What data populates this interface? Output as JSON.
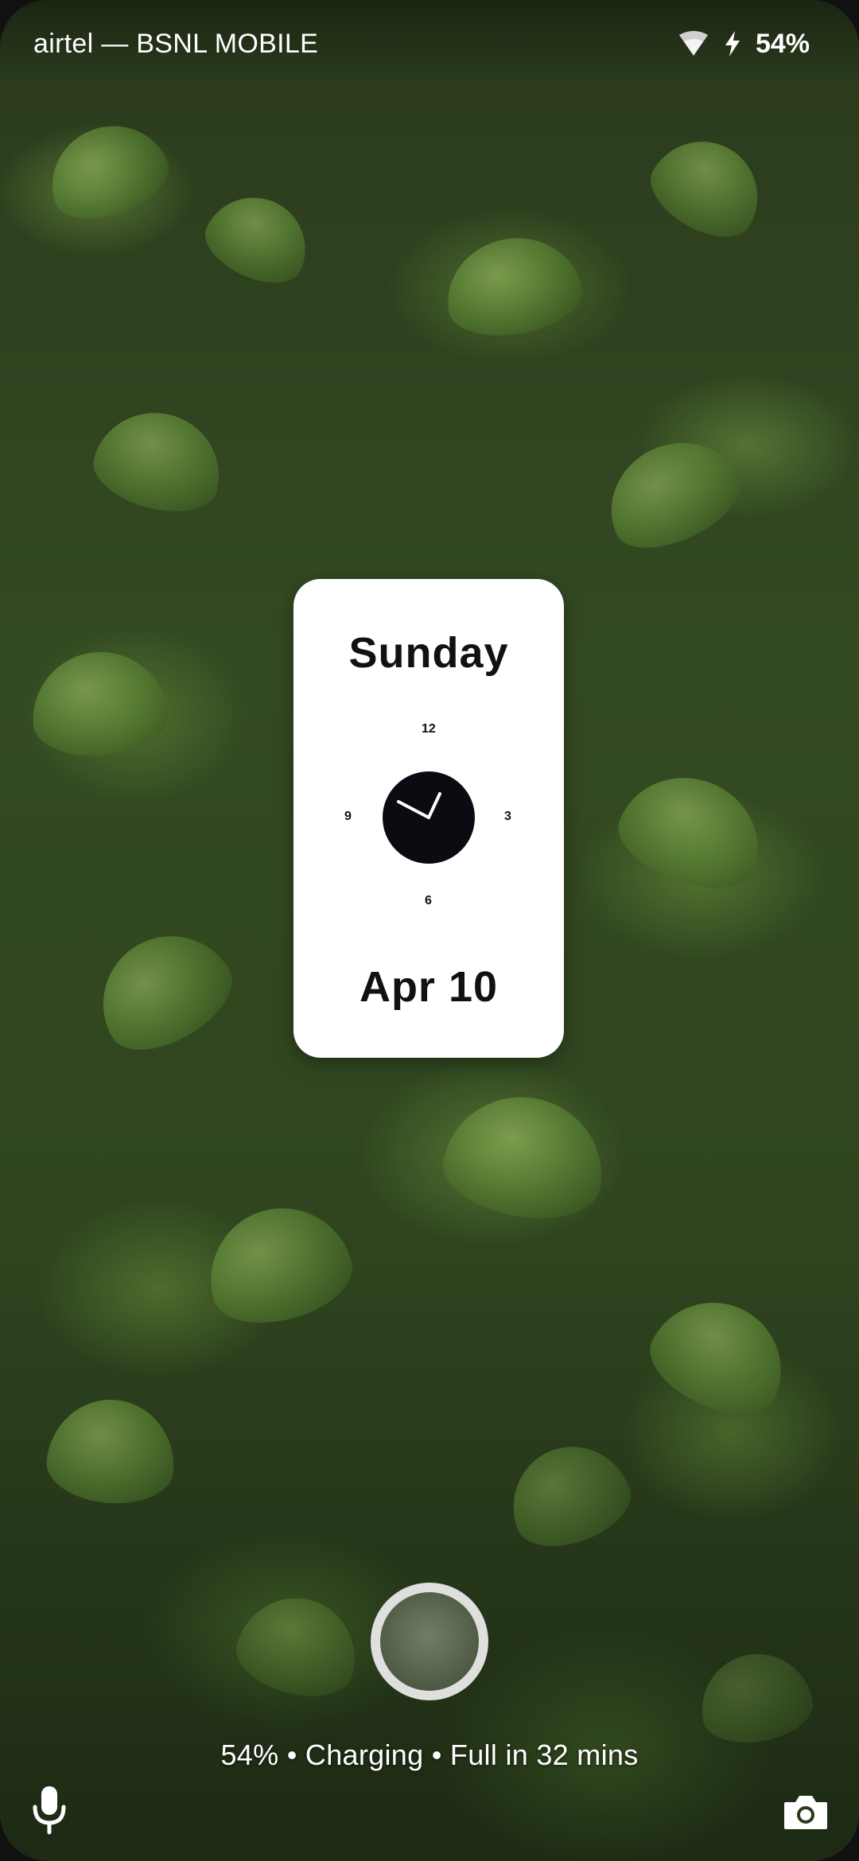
{
  "status_bar": {
    "carrier": "airtel — BSNL MOBILE",
    "battery_percent": "54%",
    "wifi_icon": "wifi-icon",
    "charging_icon": "bolt-icon"
  },
  "clock_widget": {
    "day": "Sunday",
    "date": "Apr 10",
    "dial_numbers": {
      "top": "12",
      "right": "3",
      "bottom": "6",
      "left": "9"
    }
  },
  "lockscreen": {
    "charging_status": "54% • Charging • Full in 32 mins",
    "fingerprint_icon": "fingerprint-icon",
    "left_shortcut_icon": "mic-icon",
    "right_shortcut_icon": "camera-icon"
  },
  "colors": {
    "widget_background": "#ffffff",
    "clock_face": "#0b0b12",
    "text_light": "#ffffff"
  }
}
